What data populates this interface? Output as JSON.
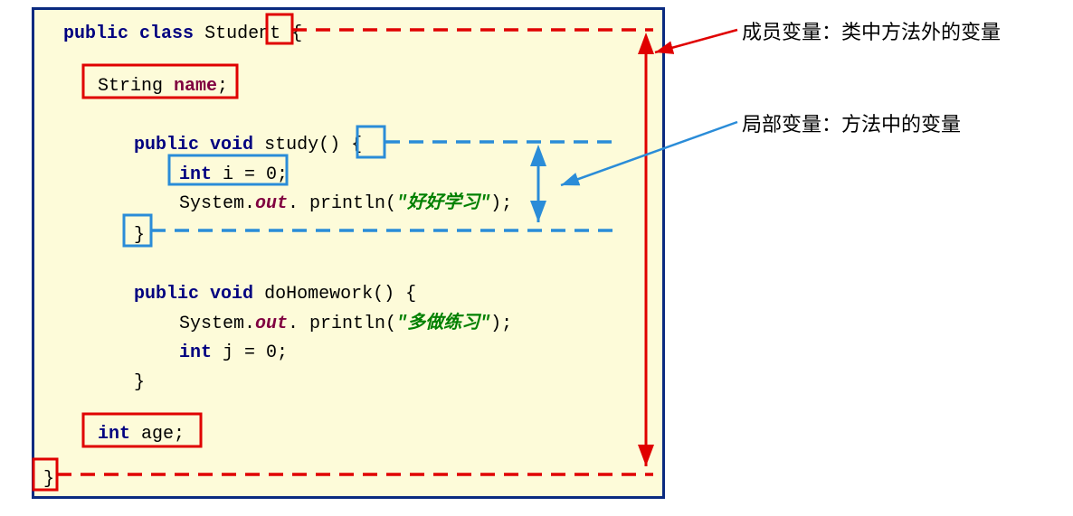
{
  "code": {
    "l1_public": "public",
    "l1_class": "class",
    "l1_name": "Student",
    "l1_brace": "{",
    "l2_type": "String",
    "l2_name": "name",
    "l2_semi": ";",
    "l3_public": "public",
    "l3_void": "void",
    "l3_method": "study",
    "l3_paren": "()",
    "l3_brace": "{",
    "l4_int": "int",
    "l4_var": "i = 0;",
    "l5_sys": "System.",
    "l5_out": "out",
    "l5_print": ". println(",
    "l5_str": "\"好好学习\"",
    "l5_end": ");",
    "l6_brace": "}",
    "l7_public": "public",
    "l7_void": "void",
    "l7_method": "doHomework",
    "l7_paren": "()",
    "l7_brace": "{",
    "l8_sys": "System.",
    "l8_out": "out",
    "l8_print": ". println(",
    "l8_str": "\"多做练习\"",
    "l8_end": ");",
    "l9_int": "int",
    "l9_var": "j = 0;",
    "l10_brace": "}",
    "l11_int": "int",
    "l11_name": "age",
    "l11_semi": ";",
    "l12_brace": "}"
  },
  "labels": {
    "member": "成员变量：类中方法外的变量",
    "local": "局部变量：方法中的变量"
  },
  "colors": {
    "red": "#e00000",
    "blue": "#2a8cd8",
    "navy": "#0a2a80"
  }
}
